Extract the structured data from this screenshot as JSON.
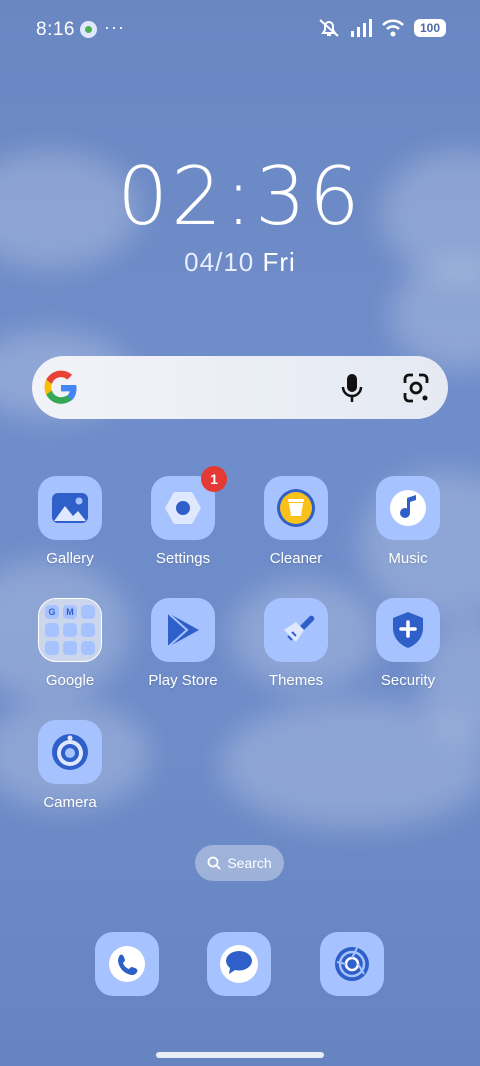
{
  "status_bar": {
    "time": "8:16",
    "more": "···",
    "battery": "100"
  },
  "clock": {
    "time": "02:36",
    "date": "04/10",
    "weekday": "Fri"
  },
  "google_search": {
    "logo": "G",
    "icons": [
      "google-logo-icon",
      "microphone-icon",
      "google-lens-icon"
    ]
  },
  "apps": [
    {
      "label": "Gallery",
      "icon": "gallery-icon"
    },
    {
      "label": "Settings",
      "icon": "settings-icon",
      "badge": "1"
    },
    {
      "label": "Cleaner",
      "icon": "trash-icon"
    },
    {
      "label": "Music",
      "icon": "music-note-icon"
    },
    {
      "label": "Google",
      "icon": "folder-icon"
    },
    {
      "label": "Play Store",
      "icon": "play-store-icon"
    },
    {
      "label": "Themes",
      "icon": "paintbrush-icon"
    },
    {
      "label": "Security",
      "icon": "shield-plus-icon"
    },
    {
      "label": "Camera",
      "icon": "camera-icon"
    }
  ],
  "google_folder_contents": [
    "G",
    "M",
    "",
    "",
    "",
    "",
    "",
    "",
    ""
  ],
  "app_search": {
    "label": "Search"
  },
  "dock": [
    {
      "icon": "phone-icon"
    },
    {
      "icon": "messages-icon"
    },
    {
      "icon": "browser-icon"
    }
  ],
  "colors": {
    "wallpaper": "#6e8cc9",
    "icon_background": "#a7c3ff",
    "icon_glyph": "#2f5fc8",
    "badge": "#e53935"
  }
}
